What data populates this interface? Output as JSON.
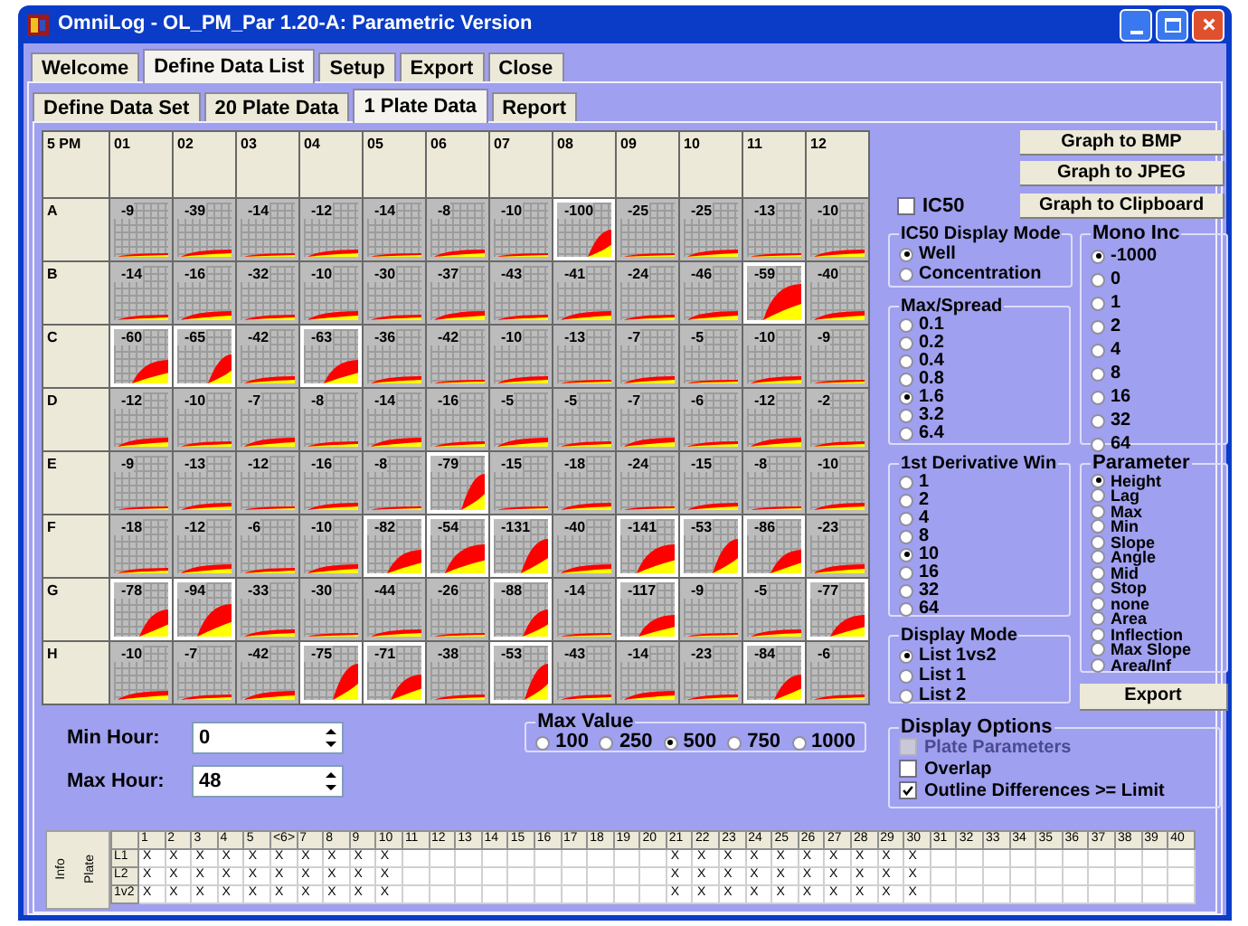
{
  "window": {
    "title": "OmniLog - OL_PM_Par 1.20-A: Parametric Version"
  },
  "tabs": [
    {
      "label": "Welcome",
      "selected": false
    },
    {
      "label": "Define Data List",
      "selected": true
    },
    {
      "label": "Setup",
      "selected": false
    },
    {
      "label": "Export",
      "selected": false
    },
    {
      "label": "Close",
      "selected": false
    }
  ],
  "subtabs": [
    {
      "label": "Define Data Set",
      "selected": false
    },
    {
      "label": "20 Plate Data",
      "selected": false
    },
    {
      "label": "1 Plate Data",
      "selected": true
    },
    {
      "label": "Report",
      "selected": false
    }
  ],
  "plate": {
    "corner": "5 PM",
    "columns": [
      "01",
      "02",
      "03",
      "04",
      "05",
      "06",
      "07",
      "08",
      "09",
      "10",
      "11",
      "12"
    ],
    "rows": [
      {
        "label": "A",
        "wells": [
          {
            "value": "-9",
            "outlined": false
          },
          {
            "value": "-39",
            "outlined": false
          },
          {
            "value": "-14",
            "outlined": false
          },
          {
            "value": "-12",
            "outlined": false
          },
          {
            "value": "-14",
            "outlined": false
          },
          {
            "value": "-8",
            "outlined": false
          },
          {
            "value": "-10",
            "outlined": false
          },
          {
            "value": "-100",
            "outlined": true
          },
          {
            "value": "-25",
            "outlined": false
          },
          {
            "value": "-25",
            "outlined": false
          },
          {
            "value": "-13",
            "outlined": false
          },
          {
            "value": "-10",
            "outlined": false
          }
        ]
      },
      {
        "label": "B",
        "wells": [
          {
            "value": "-14",
            "outlined": false
          },
          {
            "value": "-16",
            "outlined": false
          },
          {
            "value": "-32",
            "outlined": false
          },
          {
            "value": "-10",
            "outlined": false
          },
          {
            "value": "-30",
            "outlined": false
          },
          {
            "value": "-37",
            "outlined": false
          },
          {
            "value": "-43",
            "outlined": false
          },
          {
            "value": "-41",
            "outlined": false
          },
          {
            "value": "-24",
            "outlined": false
          },
          {
            "value": "-46",
            "outlined": false
          },
          {
            "value": "-59",
            "outlined": true
          },
          {
            "value": "-40",
            "outlined": false
          }
        ]
      },
      {
        "label": "C",
        "wells": [
          {
            "value": "-60",
            "outlined": true
          },
          {
            "value": "-65",
            "outlined": true
          },
          {
            "value": "-42",
            "outlined": false
          },
          {
            "value": "-63",
            "outlined": true
          },
          {
            "value": "-36",
            "outlined": false
          },
          {
            "value": "-42",
            "outlined": false
          },
          {
            "value": "-10",
            "outlined": false
          },
          {
            "value": "-13",
            "outlined": false
          },
          {
            "value": "-7",
            "outlined": false
          },
          {
            "value": "-5",
            "outlined": false
          },
          {
            "value": "-10",
            "outlined": false
          },
          {
            "value": "-9",
            "outlined": false
          }
        ]
      },
      {
        "label": "D",
        "wells": [
          {
            "value": "-12",
            "outlined": false
          },
          {
            "value": "-10",
            "outlined": false
          },
          {
            "value": "-7",
            "outlined": false
          },
          {
            "value": "-8",
            "outlined": false
          },
          {
            "value": "-14",
            "outlined": false
          },
          {
            "value": "-16",
            "outlined": false
          },
          {
            "value": "-5",
            "outlined": false
          },
          {
            "value": "-5",
            "outlined": false
          },
          {
            "value": "-7",
            "outlined": false
          },
          {
            "value": "-6",
            "outlined": false
          },
          {
            "value": "-12",
            "outlined": false
          },
          {
            "value": "-2",
            "outlined": false
          }
        ]
      },
      {
        "label": "E",
        "wells": [
          {
            "value": "-9",
            "outlined": false
          },
          {
            "value": "-13",
            "outlined": false
          },
          {
            "value": "-12",
            "outlined": false
          },
          {
            "value": "-16",
            "outlined": false
          },
          {
            "value": "-8",
            "outlined": false
          },
          {
            "value": "-79",
            "outlined": true
          },
          {
            "value": "-15",
            "outlined": false
          },
          {
            "value": "-18",
            "outlined": false
          },
          {
            "value": "-24",
            "outlined": false
          },
          {
            "value": "-15",
            "outlined": false
          },
          {
            "value": "-8",
            "outlined": false
          },
          {
            "value": "-10",
            "outlined": false
          }
        ]
      },
      {
        "label": "F",
        "wells": [
          {
            "value": "-18",
            "outlined": false
          },
          {
            "value": "-12",
            "outlined": false
          },
          {
            "value": "-6",
            "outlined": false
          },
          {
            "value": "-10",
            "outlined": false
          },
          {
            "value": "-82",
            "outlined": true
          },
          {
            "value": "-54",
            "outlined": true
          },
          {
            "value": "-131",
            "outlined": true
          },
          {
            "value": "-40",
            "outlined": false
          },
          {
            "value": "-141",
            "outlined": true
          },
          {
            "value": "-53",
            "outlined": true
          },
          {
            "value": "-86",
            "outlined": true
          },
          {
            "value": "-23",
            "outlined": false
          }
        ]
      },
      {
        "label": "G",
        "wells": [
          {
            "value": "-78",
            "outlined": true
          },
          {
            "value": "-94",
            "outlined": true
          },
          {
            "value": "-33",
            "outlined": false
          },
          {
            "value": "-30",
            "outlined": false
          },
          {
            "value": "-44",
            "outlined": false
          },
          {
            "value": "-26",
            "outlined": false
          },
          {
            "value": "-88",
            "outlined": true
          },
          {
            "value": "-14",
            "outlined": false
          },
          {
            "value": "-117",
            "outlined": true
          },
          {
            "value": "-9",
            "outlined": false
          },
          {
            "value": "-5",
            "outlined": false
          },
          {
            "value": "-77",
            "outlined": true
          }
        ]
      },
      {
        "label": "H",
        "wells": [
          {
            "value": "-10",
            "outlined": false
          },
          {
            "value": "-7",
            "outlined": false
          },
          {
            "value": "-42",
            "outlined": false
          },
          {
            "value": "-75",
            "outlined": true
          },
          {
            "value": "-71",
            "outlined": true
          },
          {
            "value": "-38",
            "outlined": false
          },
          {
            "value": "-53",
            "outlined": true
          },
          {
            "value": "-43",
            "outlined": false
          },
          {
            "value": "-14",
            "outlined": false
          },
          {
            "value": "-23",
            "outlined": false
          },
          {
            "value": "-84",
            "outlined": true
          },
          {
            "value": "-6",
            "outlined": false
          }
        ]
      }
    ]
  },
  "graph_buttons": [
    "Graph to BMP",
    "Graph to JPEG",
    "Graph to Clipboard"
  ],
  "ic50": {
    "label": "IC50",
    "checked": false
  },
  "left_groups": [
    {
      "title": "IC50 Display Mode",
      "options": [
        {
          "label": "Well",
          "selected": true
        },
        {
          "label": "Concentration",
          "selected": false
        }
      ]
    },
    {
      "title": "Max/Spread",
      "options": [
        {
          "label": "0.1",
          "selected": false
        },
        {
          "label": "0.2",
          "selected": false
        },
        {
          "label": "0.4",
          "selected": false
        },
        {
          "label": "0.8",
          "selected": false
        },
        {
          "label": "1.6",
          "selected": true
        },
        {
          "label": "3.2",
          "selected": false
        },
        {
          "label": "6.4",
          "selected": false
        }
      ]
    },
    {
      "title": "1st Derivative Win",
      "options": [
        {
          "label": "1",
          "selected": false
        },
        {
          "label": "2",
          "selected": false
        },
        {
          "label": "4",
          "selected": false
        },
        {
          "label": "8",
          "selected": false
        },
        {
          "label": "10",
          "selected": true
        },
        {
          "label": "16",
          "selected": false
        },
        {
          "label": "32",
          "selected": false
        },
        {
          "label": "64",
          "selected": false
        }
      ]
    },
    {
      "title": "Display Mode",
      "options": [
        {
          "label": "List 1vs2",
          "selected": true
        },
        {
          "label": "List 1",
          "selected": false
        },
        {
          "label": "List 2",
          "selected": false
        }
      ]
    }
  ],
  "right_groups": [
    {
      "title": "Mono Inc",
      "options": [
        {
          "label": "-1000",
          "selected": true
        },
        {
          "label": "0",
          "selected": false
        },
        {
          "label": "1",
          "selected": false
        },
        {
          "label": "2",
          "selected": false
        },
        {
          "label": "4",
          "selected": false
        },
        {
          "label": "8",
          "selected": false
        },
        {
          "label": "16",
          "selected": false
        },
        {
          "label": "32",
          "selected": false
        },
        {
          "label": "64",
          "selected": false
        }
      ]
    },
    {
      "title": "Parameter",
      "options": [
        {
          "label": "Height",
          "selected": true
        },
        {
          "label": "Lag",
          "selected": false
        },
        {
          "label": "Max",
          "selected": false
        },
        {
          "label": "Min",
          "selected": false
        },
        {
          "label": "Slope",
          "selected": false
        },
        {
          "label": "Angle",
          "selected": false
        },
        {
          "label": "Mid",
          "selected": false
        },
        {
          "label": "Stop",
          "selected": false
        },
        {
          "label": "none",
          "selected": false
        },
        {
          "label": "Area",
          "selected": false
        },
        {
          "label": "Inflection",
          "selected": false
        },
        {
          "label": "Max Slope",
          "selected": false
        },
        {
          "label": "Area/Inf",
          "selected": false
        }
      ]
    }
  ],
  "export_button": "Export",
  "display_options": {
    "title": "Display Options",
    "items": [
      {
        "label": "Plate Parameters",
        "checked": false,
        "disabled": true
      },
      {
        "label": "Overlap",
        "checked": false,
        "disabled": false
      },
      {
        "label": "Outline Differences >= Limit",
        "checked": true,
        "disabled": false
      }
    ]
  },
  "hours": [
    {
      "label": "Min Hour:",
      "value": "0"
    },
    {
      "label": "Max Hour:",
      "value": "48"
    }
  ],
  "max_value": {
    "title": "Max Value",
    "options": [
      {
        "label": "100",
        "selected": false
      },
      {
        "label": "250",
        "selected": false
      },
      {
        "label": "500",
        "selected": true
      },
      {
        "label": "750",
        "selected": false
      },
      {
        "label": "1000",
        "selected": false
      }
    ]
  },
  "info_table": {
    "side_labels": [
      "Info",
      "Plate"
    ],
    "columns": [
      "1",
      "2",
      "3",
      "4",
      "5",
      "<6>",
      "7",
      "8",
      "9",
      "10",
      "11",
      "12",
      "13",
      "14",
      "15",
      "16",
      "17",
      "18",
      "19",
      "20",
      "21",
      "22",
      "23",
      "24",
      "25",
      "26",
      "27",
      "28",
      "29",
      "30",
      "31",
      "32",
      "33",
      "34",
      "35",
      "36",
      "37",
      "38",
      "39",
      "40"
    ],
    "rows": [
      {
        "label": "L1",
        "cells": [
          {
            "mark": "X"
          },
          {
            "mark": "X"
          },
          {
            "mark": "X"
          },
          {
            "mark": "X"
          },
          {
            "mark": "X"
          },
          {
            "mark": "X"
          },
          {
            "mark": "X"
          },
          {
            "mark": "X"
          },
          {
            "mark": "X"
          },
          {
            "mark": "X"
          },
          {},
          {},
          {},
          {},
          {},
          {},
          {},
          {},
          {},
          {},
          {
            "mark": "X"
          },
          {
            "mark": "X"
          },
          {
            "mark": "X"
          },
          {
            "mark": "X"
          },
          {
            "mark": "X"
          },
          {
            "mark": "X"
          },
          {
            "mark": "X"
          },
          {
            "mark": "X"
          },
          {
            "mark": "X"
          },
          {
            "mark": "X"
          },
          {},
          {},
          {},
          {},
          {},
          {},
          {},
          {},
          {},
          {}
        ]
      },
      {
        "label": "L2",
        "cells": [
          {
            "mark": "X"
          },
          {
            "mark": "X"
          },
          {
            "mark": "X"
          },
          {
            "mark": "X"
          },
          {
            "mark": "X"
          },
          {
            "mark": "X"
          },
          {
            "mark": "X"
          },
          {
            "mark": "X"
          },
          {
            "mark": "X"
          },
          {
            "mark": "X"
          },
          {},
          {},
          {},
          {},
          {},
          {},
          {},
          {},
          {},
          {},
          {
            "mark": "X"
          },
          {
            "mark": "X"
          },
          {
            "mark": "X"
          },
          {
            "mark": "X"
          },
          {
            "mark": "X"
          },
          {
            "mark": "X"
          },
          {
            "mark": "X"
          },
          {
            "mark": "X"
          },
          {
            "mark": "X"
          },
          {
            "mark": "X"
          },
          {},
          {},
          {},
          {},
          {},
          {},
          {},
          {},
          {},
          {}
        ]
      },
      {
        "label": "1v2",
        "cells": [
          {
            "mark": "X"
          },
          {
            "mark": "X"
          },
          {
            "mark": "X"
          },
          {
            "mark": "X"
          },
          {
            "mark": "X"
          },
          {
            "mark": "X"
          },
          {
            "mark": "X"
          },
          {
            "mark": "X"
          },
          {
            "mark": "X"
          },
          {
            "mark": "X"
          },
          {},
          {},
          {},
          {},
          {},
          {},
          {},
          {},
          {},
          {},
          {
            "mark": "X"
          },
          {
            "mark": "X"
          },
          {
            "mark": "X"
          },
          {
            "mark": "X"
          },
          {
            "mark": "X"
          },
          {
            "mark": "X"
          },
          {
            "mark": "X"
          },
          {
            "mark": "X"
          },
          {
            "mark": "X"
          },
          {
            "mark": "X"
          },
          {},
          {},
          {},
          {},
          {},
          {},
          {},
          {},
          {},
          {}
        ]
      }
    ]
  }
}
